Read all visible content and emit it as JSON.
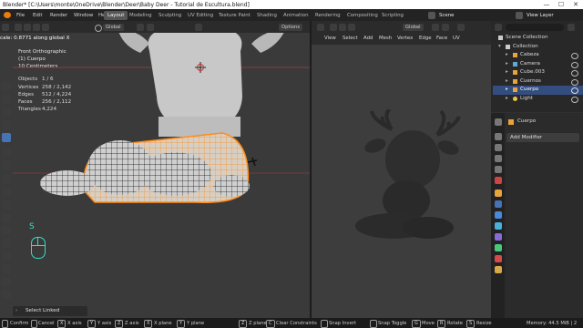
{
  "titlebar": {
    "title": "Blender* [C:\\Users\\monte\\OneDrive\\Blender\\Deer\\Baby Deer - Tutorial de Escultura.blend]",
    "minimize": "—",
    "maximize": "☐",
    "close": "✕"
  },
  "menubar": {
    "items": [
      "File",
      "Edit",
      "Render",
      "Window",
      "Help"
    ],
    "workspaces": [
      "Layout",
      "Modeling",
      "Sculpting",
      "UV Editing",
      "Texture Paint",
      "Shading",
      "Animation",
      "Rendering",
      "Compositing",
      "Scripting"
    ],
    "scene": "Scene",
    "view_layer": "View Layer"
  },
  "viewport_left": {
    "orientation": "Global",
    "options": "Options",
    "operator_hint": "cale: 0.8771 along global X",
    "view_name": "Front Orthographic",
    "object_name": "(1) Cuerpo",
    "scale_text": "10 Centimeters",
    "stats": {
      "objects_label": "Objects",
      "objects_value": "1 / 6",
      "vertices_label": "Vertices",
      "vertices_value": "258 / 2,142",
      "edges_label": "Edges",
      "edges_value": "512 / 4,224",
      "faces_label": "Faces",
      "faces_value": "256 / 2,112",
      "triangles_label": "Triangles",
      "triangles_value": "4,224"
    },
    "key_overlay": "S",
    "last_operator": "Select Linked"
  },
  "viewport_right": {
    "menus": [
      "View",
      "Select",
      "Add",
      "Mesh",
      "Vertex",
      "Edge",
      "Face",
      "UV"
    ],
    "orientation": "Global"
  },
  "outliner": {
    "search_placeholder": "",
    "root": "Scene Collection",
    "collection": "Collection",
    "items": [
      {
        "label": "Cabeza",
        "selected": false,
        "color": "#e8a33b"
      },
      {
        "label": "Camera",
        "selected": false,
        "color": "#5fa8d8"
      },
      {
        "label": "Cube.003",
        "selected": false,
        "color": "#e8a33b"
      },
      {
        "label": "Cuernos",
        "selected": false,
        "color": "#e8a33b"
      },
      {
        "label": "Cuerpo",
        "selected": true,
        "color": "#e8a33b"
      },
      {
        "label": "Light",
        "selected": false,
        "color": "#e8c44b"
      }
    ]
  },
  "properties": {
    "object_name": "Cuerpo",
    "add_modifier": "Add Modifier"
  },
  "statusbar": {
    "items": [
      {
        "key": "",
        "label": "Confirm"
      },
      {
        "key": "",
        "label": "Cancel"
      },
      {
        "key": "X",
        "label": "X axis"
      },
      {
        "key": "Y",
        "label": "Y axis"
      },
      {
        "key": "Z",
        "label": "Z axis"
      },
      {
        "key": "X",
        "label": "X plane"
      },
      {
        "key": "Y",
        "label": "Y plane"
      },
      {
        "key": "Z",
        "label": "Z plane"
      },
      {
        "key": "C",
        "label": "Clear Constraints"
      },
      {
        "key": "",
        "label": "Snap Invert"
      },
      {
        "key": "",
        "label": "Snap Toggle"
      },
      {
        "key": "G",
        "label": "Move"
      },
      {
        "key": "R",
        "label": "Rotate"
      },
      {
        "key": "S",
        "label": "Resize"
      }
    ],
    "memory": "Memory: 44.5 MiB | 2"
  },
  "colors": {
    "accent": "#4772b3",
    "selection_orange": "#ff8c1a",
    "ui_dark": "#232323"
  }
}
